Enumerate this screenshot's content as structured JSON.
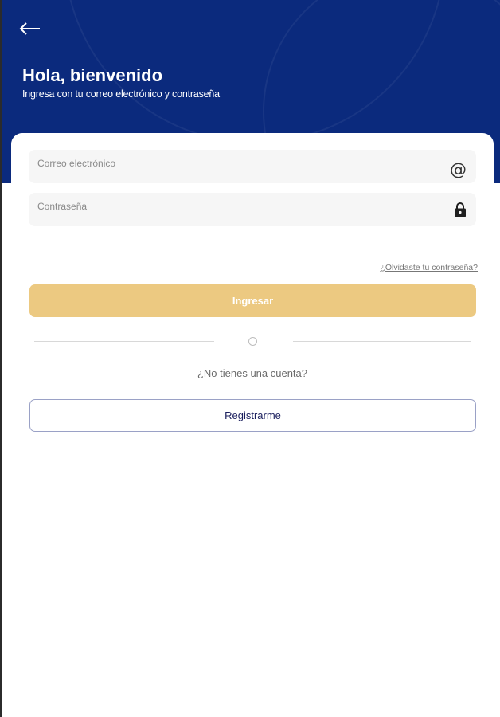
{
  "header": {
    "title": "Hola, bienvenido",
    "subtitle": "Ingresa con tu correo electrónico y contraseña",
    "back_icon": "arrow-left-icon"
  },
  "form": {
    "email": {
      "placeholder": "Correo electrónico",
      "value": "",
      "icon": "at-sign-icon"
    },
    "password": {
      "placeholder": "Contraseña",
      "value": "",
      "icon": "lock-icon"
    },
    "forgot_password": "¿Olvidaste tu contraseña?",
    "submit_label": "Ingresar"
  },
  "signup": {
    "prompt": "¿No tienes una cuenta?",
    "button_label": "Registrarme"
  },
  "colors": {
    "header_bg": "#0b2a7d",
    "primary_button": "#ecc981",
    "secondary_border": "#9aa1c6",
    "secondary_text": "#1b1f5e",
    "field_bg": "#f6f6f6"
  }
}
